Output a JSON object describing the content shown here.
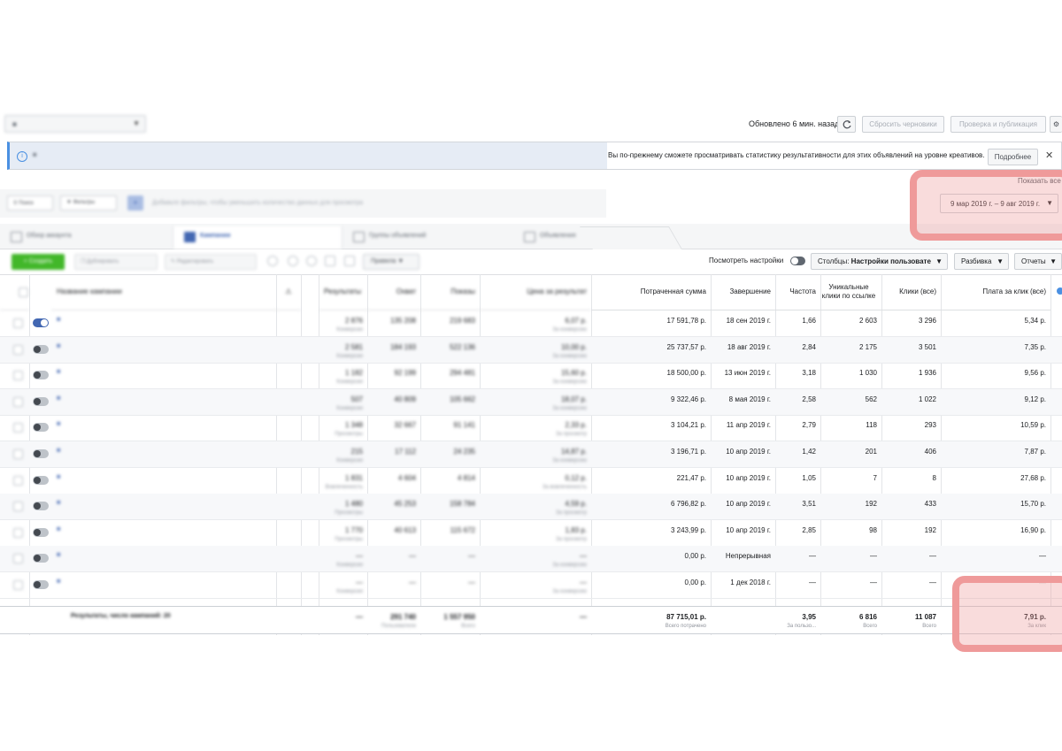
{
  "topbar": {
    "account_name": "■",
    "updated": "Обновлено 6 мин. назад",
    "discard_label": "Сбросить черновики",
    "publish_label": "Проверка и публикация"
  },
  "notice": {
    "text_blurred": "■",
    "text_visible": "Вы по-прежнему сможете просматривать статистику результативности для этих объявлений на уровне креативов.",
    "more_label": "Подробнее",
    "close_glyph": "✕",
    "show_all": "Показать все"
  },
  "filters": {
    "search_label": "Поиск",
    "filters_label": "Фильтры",
    "hint": "Добавьте фильтры, чтобы уменьшить количество данных для просмотра",
    "date_range": "9 мар 2019 г. – 9 авг 2019 г."
  },
  "tabs": [
    {
      "label": "Обзор аккаунта"
    },
    {
      "label": "Кампании"
    },
    {
      "label": "Группы объявлений"
    },
    {
      "label": "Объявления"
    }
  ],
  "toolbar": {
    "create_label": "Создать",
    "duplicate_label": "Дублировать",
    "edit_label": "Редактировать",
    "rules_label": "Правила",
    "view_settings": "Посмотреть настройки",
    "columns_label": "Столбцы:",
    "columns_value": "Настройки пользовате",
    "breakdown_label": "Разбивка",
    "reports_label": "Отчеты"
  },
  "table": {
    "headers": {
      "name": "Название кампании",
      "results": "Результаты",
      "reach": "Охват",
      "impressions": "Показы",
      "cost_per_result": "Цена за результат",
      "spent": "Потраченная сумма",
      "end": "Завершение",
      "frequency": "Частота",
      "unique_clicks": "Уникальные клики по ссылке",
      "clicks_all": "Клики (все)",
      "cpc_all": "Плата за клик (все)"
    },
    "rows": [
      {
        "name": "■",
        "on": true,
        "results": "2 876",
        "results_sub": "Конверсии",
        "reach": "135 208",
        "impr": "219 683",
        "cpr": "6,07 р.",
        "cpr_sub": "За конверсию",
        "spent": "17 591,78 р.",
        "end": "18 сен 2019 г.",
        "freq": "1,66",
        "uclicks": "2 603",
        "clicks": "3 296",
        "cpc": "5,34 р."
      },
      {
        "name": "■",
        "on": false,
        "results": "2 581",
        "results_sub": "Конверсии",
        "reach": "184 193",
        "impr": "522 136",
        "cpr": "10,00 р.",
        "cpr_sub": "За конверсию",
        "spent": "25 737,57 р.",
        "end": "18 авг 2019 г.",
        "freq": "2,84",
        "uclicks": "2 175",
        "clicks": "3 501",
        "cpc": "7,35 р."
      },
      {
        "name": "■",
        "on": false,
        "results": "1 182",
        "results_sub": "Конверсии",
        "reach": "92 199",
        "impr": "294 481",
        "cpr": "15,60 р.",
        "cpr_sub": "За конверсию",
        "spent": "18 500,00 р.",
        "end": "13 июн 2019 г.",
        "freq": "3,18",
        "uclicks": "1 030",
        "clicks": "1 936",
        "cpc": "9,56 р."
      },
      {
        "name": "■",
        "on": false,
        "results": "507",
        "results_sub": "Конверсии",
        "reach": "40 809",
        "impr": "105 662",
        "cpr": "18,07 р.",
        "cpr_sub": "За конверсию",
        "spent": "9 322,46 р.",
        "end": "8 мая 2019 г.",
        "freq": "2,58",
        "uclicks": "562",
        "clicks": "1 022",
        "cpc": "9,12 р."
      },
      {
        "name": "■",
        "on": false,
        "results": "1 348",
        "results_sub": "Просмотры",
        "reach": "32 667",
        "impr": "91 141",
        "cpr": "2,33 р.",
        "cpr_sub": "За просмотр",
        "spent": "3 104,21 р.",
        "end": "11 апр 2019 г.",
        "freq": "2,79",
        "uclicks": "118",
        "clicks": "293",
        "cpc": "10,59 р."
      },
      {
        "name": "■",
        "on": false,
        "results": "215",
        "results_sub": "Конверсии",
        "reach": "17 112",
        "impr": "24 235",
        "cpr": "14,87 р.",
        "cpr_sub": "За конверсию",
        "spent": "3 196,71 р.",
        "end": "10 апр 2019 г.",
        "freq": "1,42",
        "uclicks": "201",
        "clicks": "406",
        "cpc": "7,87 р."
      },
      {
        "name": "■",
        "on": false,
        "results": "1 831",
        "results_sub": "Вовлеченность",
        "reach": "4 604",
        "impr": "4 814",
        "cpr": "0,12 р.",
        "cpr_sub": "За вовлеченность",
        "spent": "221,47 р.",
        "end": "10 апр 2019 г.",
        "freq": "1,05",
        "uclicks": "7",
        "clicks": "8",
        "cpc": "27,68 р."
      },
      {
        "name": "■",
        "on": false,
        "results": "1 480",
        "results_sub": "Просмотры",
        "reach": "45 253",
        "impr": "158 784",
        "cpr": "4,59 р.",
        "cpr_sub": "За просмотр",
        "spent": "6 796,82 р.",
        "end": "10 апр 2019 г.",
        "freq": "3,51",
        "uclicks": "192",
        "clicks": "433",
        "cpc": "15,70 р."
      },
      {
        "name": "■",
        "on": false,
        "results": "1 770",
        "results_sub": "Просмотры",
        "reach": "40 613",
        "impr": "115 672",
        "cpr": "1,83 р.",
        "cpr_sub": "За просмотр",
        "spent": "3 243,99 р.",
        "end": "10 апр 2019 г.",
        "freq": "2,85",
        "uclicks": "98",
        "clicks": "192",
        "cpc": "16,90 р."
      },
      {
        "name": "■",
        "on": false,
        "results": "—",
        "results_sub": "Конверсии",
        "reach": "—",
        "impr": "—",
        "cpr": "—",
        "cpr_sub": "За конверсию",
        "spent": "0,00 р.",
        "end": "Непрерывная",
        "freq": "—",
        "uclicks": "—",
        "clicks": "—",
        "cpc": "—"
      },
      {
        "name": "■",
        "on": false,
        "results": "—",
        "results_sub": "Конверсии",
        "reach": "—",
        "impr": "—",
        "cpr": "—",
        "cpr_sub": "За конверсию",
        "spent": "0,00 р.",
        "end": "1 дек 2018 г.",
        "freq": "—",
        "uclicks": "—",
        "clicks": "—",
        "cpc": "—"
      }
    ],
    "total": {
      "label": "Результаты, число кампаний: 20",
      "results": "—",
      "reach": "291 740",
      "reach_sub": "Пользователи",
      "impr": "1 557 950",
      "impr_sub": "Всего",
      "cpr": "—",
      "spent": "87 715,01 р.",
      "spent_sub": "Всего потрачено",
      "freq": "3,95",
      "freq_sub": "За пользо...",
      "uclicks": "6 816",
      "uclicks_sub": "Всего",
      "clicks": "11 087",
      "clicks_sub": "Всего",
      "cpc": "7,91 р.",
      "cpc_sub": "За клик"
    }
  },
  "colors": {
    "accent": "#4267b2",
    "create": "#42b72a",
    "highlight": "#ef9a9a"
  }
}
